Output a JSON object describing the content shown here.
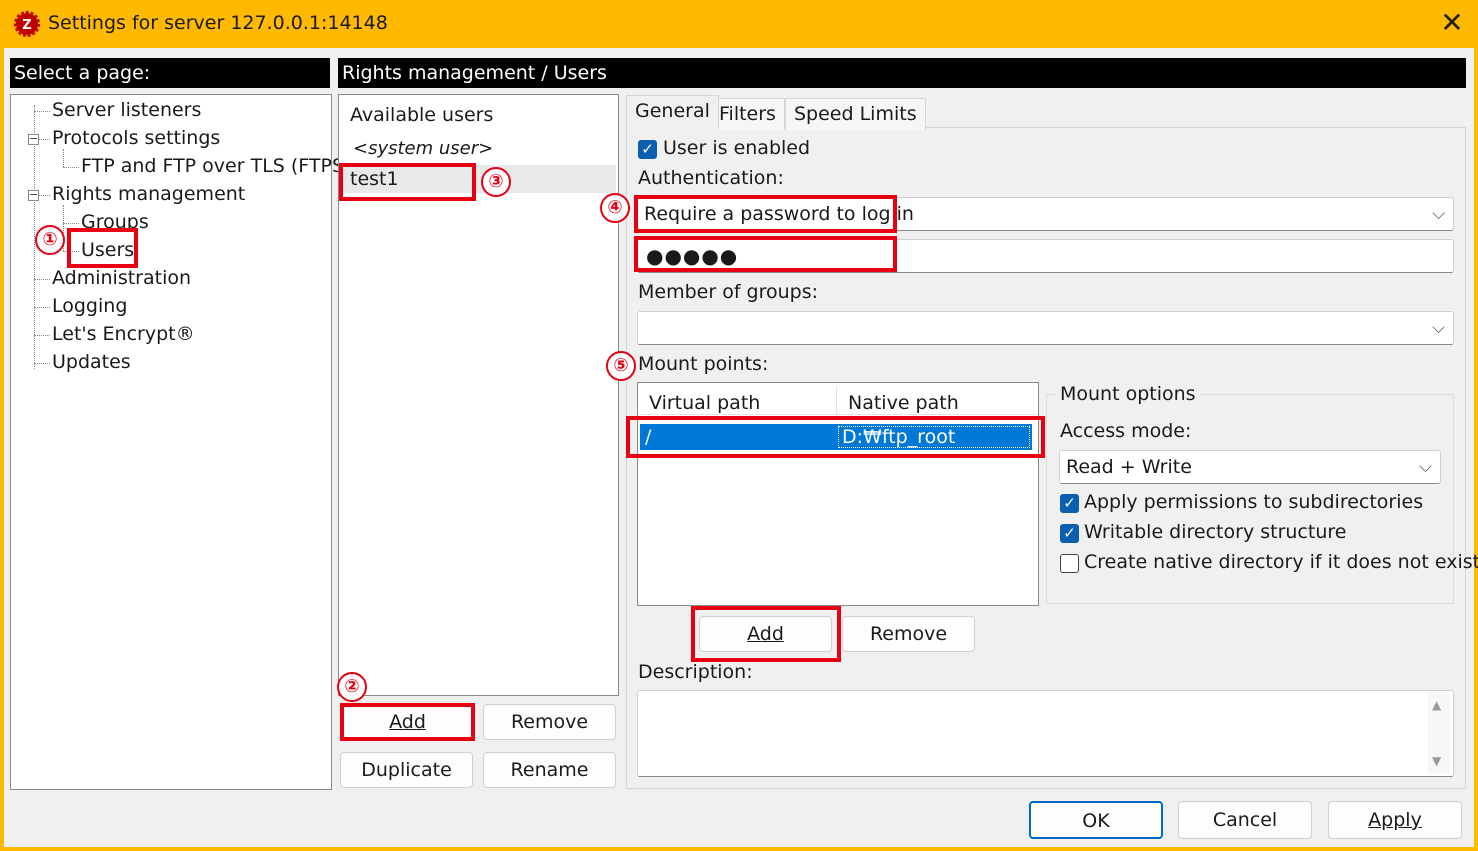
{
  "window": {
    "title": "Settings for server 127.0.0.1:14148",
    "close_glyph": "✕",
    "icon": "filezilla-server-icon"
  },
  "left_header": "Select a page:",
  "right_header": "Rights management / Users",
  "tree": {
    "server_listeners": "Server listeners",
    "protocols_settings": "Protocols settings",
    "ftp_ftps": "FTP and FTP over TLS (FTPS)",
    "rights_management": "Rights management",
    "groups": "Groups",
    "users": "Users",
    "administration": "Administration",
    "logging": "Logging",
    "lets_encrypt": "Let's Encrypt®",
    "updates": "Updates",
    "expander_glyph": "−"
  },
  "users": {
    "header": "Available users",
    "system_user": "<system user>",
    "selected_user": "test1",
    "buttons": {
      "add": "Add",
      "remove": "Remove",
      "duplicate": "Duplicate",
      "rename": "Rename"
    }
  },
  "tabs": [
    "General",
    "Filters",
    "Speed Limits"
  ],
  "general": {
    "user_enabled_label": "User is enabled",
    "user_enabled": true,
    "authentication_label": "Authentication:",
    "authentication_value": "Require a password to log in",
    "password_mask": "●●●●●",
    "member_of_groups_label": "Member of groups:",
    "member_of_groups_value": "",
    "mount_points_label": "Mount points:",
    "mount_columns": [
      "Virtual path",
      "Native path"
    ],
    "mount_rows": [
      {
        "virtual": "/",
        "native": "D:₩ftp_root"
      }
    ],
    "mount_buttons": {
      "add": "Add",
      "remove": "Remove"
    },
    "mount_options": {
      "title": "Mount options",
      "access_mode_label": "Access mode:",
      "access_mode_value": "Read + Write",
      "apply_permissions_label": "Apply permissions to subdirectories",
      "apply_permissions": true,
      "writable_label": "Writable directory structure",
      "writable": true,
      "create_native_label": "Create native directory if it does not exist",
      "create_native": false
    },
    "description_label": "Description:",
    "description_value": ""
  },
  "footer": {
    "ok": "OK",
    "cancel": "Cancel",
    "apply": "Apply"
  },
  "annotations": {
    "n1": "①",
    "n2": "②",
    "n3": "③",
    "n4": "④",
    "n5": "⑤",
    "color": "#e60012"
  },
  "colors": {
    "titlebar": "#ffb900",
    "selection": "#0078d7",
    "checkbox": "#0a5fb0"
  }
}
